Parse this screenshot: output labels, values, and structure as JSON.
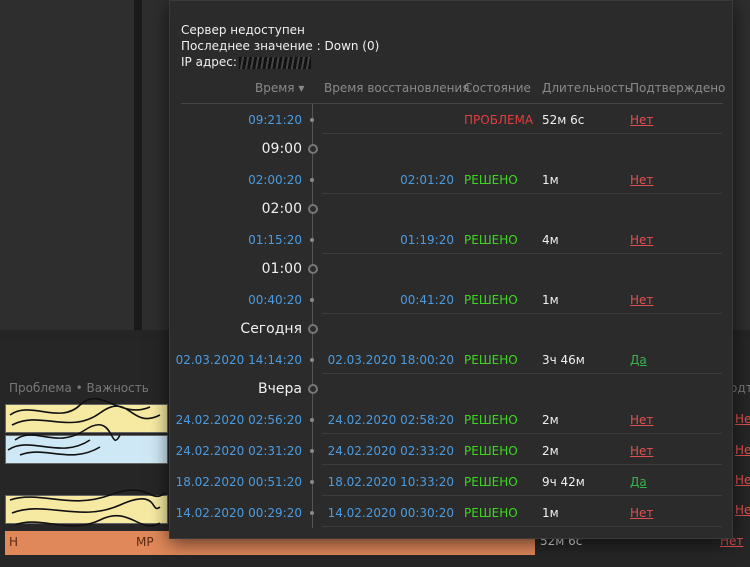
{
  "background": {
    "column_header_left": "Проблема • Важность",
    "column_header_right": "одтв",
    "right_links": [
      "Нет",
      "Нет",
      "Нет",
      "Нет"
    ],
    "bottom_row": {
      "text": "Н",
      "text_tail": "МР",
      "duration": "52м 6с",
      "ack": "Нет"
    }
  },
  "popup": {
    "title": "Сервер недоступен",
    "last_value": "Последнее значение : Down (0)",
    "ip_label": "IP адрес:",
    "headers": {
      "time": "Время ▾",
      "recovery": "Время восстановления",
      "state": "Состояние",
      "duration": "Длительность",
      "ack": "Подтверждено"
    },
    "entries": [
      {
        "kind": "row",
        "time": "09:21:20",
        "recovery": "",
        "state": "ПРОБЛЕМА",
        "state_type": "problem",
        "duration": "52м 6с",
        "ack": "Нет",
        "ack_type": "no"
      },
      {
        "kind": "marker",
        "label": "09:00"
      },
      {
        "kind": "row",
        "time": "02:00:20",
        "recovery": "02:01:20",
        "state": "РЕШЕНО",
        "state_type": "ok",
        "duration": "1м",
        "ack": "Нет",
        "ack_type": "no"
      },
      {
        "kind": "marker",
        "label": "02:00"
      },
      {
        "kind": "row",
        "time": "01:15:20",
        "recovery": "01:19:20",
        "state": "РЕШЕНО",
        "state_type": "ok",
        "duration": "4м",
        "ack": "Нет",
        "ack_type": "no"
      },
      {
        "kind": "marker",
        "label": "01:00"
      },
      {
        "kind": "row",
        "time": "00:40:20",
        "recovery": "00:41:20",
        "state": "РЕШЕНО",
        "state_type": "ok",
        "duration": "1м",
        "ack": "Нет",
        "ack_type": "no"
      },
      {
        "kind": "marker",
        "label": "Сегодня"
      },
      {
        "kind": "row",
        "time": "02.03.2020 14:14:20",
        "recovery": "02.03.2020 18:00:20",
        "state": "РЕШЕНО",
        "state_type": "ok",
        "duration": "3ч 46м",
        "ack": "Да",
        "ack_type": "yes"
      },
      {
        "kind": "marker",
        "label": "Вчера"
      },
      {
        "kind": "row",
        "time": "24.02.2020 02:56:20",
        "recovery": "24.02.2020 02:58:20",
        "state": "РЕШЕНО",
        "state_type": "ok",
        "duration": "2м",
        "ack": "Нет",
        "ack_type": "no"
      },
      {
        "kind": "row",
        "time": "24.02.2020 02:31:20",
        "recovery": "24.02.2020 02:33:20",
        "state": "РЕШЕНО",
        "state_type": "ok",
        "duration": "2м",
        "ack": "Нет",
        "ack_type": "no"
      },
      {
        "kind": "row",
        "time": "18.02.2020 00:51:20",
        "recovery": "18.02.2020 10:33:20",
        "state": "РЕШЕНО",
        "state_type": "ok",
        "duration": "9ч 42м",
        "ack": "Да",
        "ack_type": "yes"
      },
      {
        "kind": "row",
        "time": "14.02.2020 00:29:20",
        "recovery": "14.02.2020 00:30:20",
        "state": "РЕШЕНО",
        "state_type": "ok",
        "duration": "1м",
        "ack": "Нет",
        "ack_type": "no"
      }
    ]
  },
  "colors": {
    "link_blue": "#4c9bde",
    "ok_green": "#3fd61f",
    "problem_red": "#e53c3c",
    "ack_yes": "#37b24d",
    "ack_no": "#e05050"
  }
}
